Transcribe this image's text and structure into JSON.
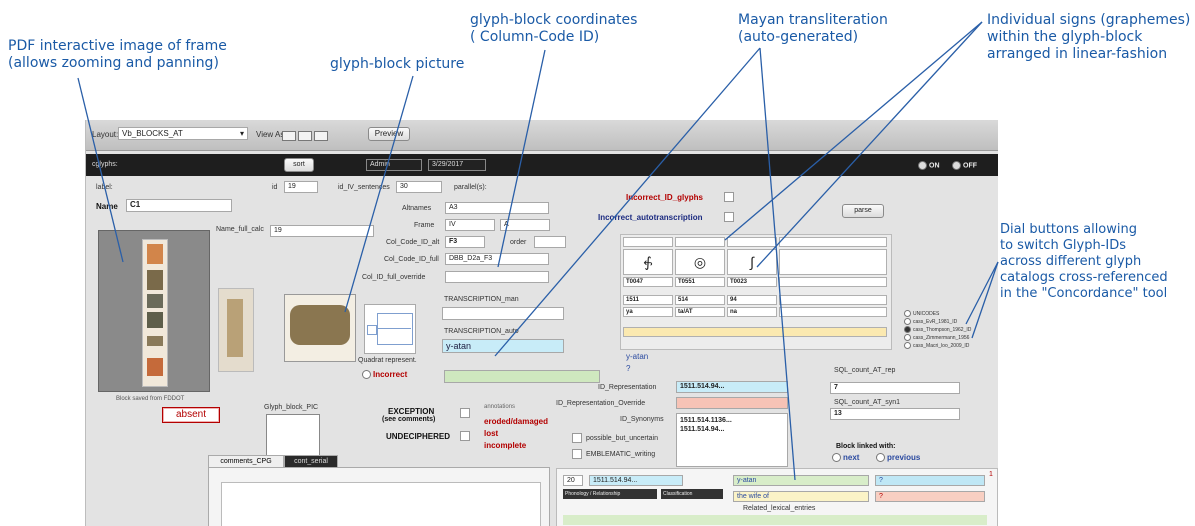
{
  "annotations": {
    "pdf_frame": [
      "PDF interactive image of frame",
      "(allows zooming and panning)"
    ],
    "glyph_block_picture": "glyph-block picture",
    "glyph_block_coordinates": [
      "glyph-block coordinates",
      "( Column-Code ID)"
    ],
    "mayan_transliteration": [
      "Mayan transliteration",
      "(auto-generated)"
    ],
    "individual_signs": [
      "Individual signs (graphemes)",
      "within the glyph-block",
      "arranged in linear-fashion"
    ],
    "dial_buttons": [
      "Dial buttons allowing",
      "to switch Glyph-IDs",
      "across different glyph",
      "catalogs cross-referenced",
      "in the \"Concordance\" tool"
    ]
  },
  "toolbar": {
    "layout_label": "Layout:",
    "layout_value": "Vb_BLOCKS_AT",
    "view_as_label": "View As:",
    "preview_label": "Preview"
  },
  "header": {
    "glyphs_label": "cglyphs:",
    "sort_label": "sort",
    "user_value": "Admin",
    "date_value": "3/29/2017",
    "on_label": "ON",
    "off_label": "OFF"
  },
  "form": {
    "label_label": "label:",
    "id_label": "id",
    "id_value": "19",
    "id_iv_label": "id_IV_sentences",
    "id_iv_value": "30",
    "parallels_label": "parallel(s):",
    "name_label": "Name",
    "name_value": "C1",
    "name_full_calc_label": "Name_full_calc",
    "name_full_calc_value": "19",
    "altnames_label": "Altnames",
    "altnames_value": "A3",
    "frame_label": "Frame",
    "frame_value": "IV",
    "frame_col_value": "A",
    "col_code_auto_label": "Col_Code_ID_alt",
    "col_code_auto_value": "F3",
    "order_label": "order",
    "col_code_full_label": "Col_Code_ID_full",
    "col_code_full_value": "DBB_D2a_F3",
    "col_id_override_label": "Col_ID_full_override",
    "incorrect_id_glyphs": "Incorrect_ID_glyphs",
    "incorrect_autotranscription": "Incorrect_autotranscription",
    "parse_label": "parse",
    "transcription_man_label": "TRANSCRIPTION_man",
    "transcription_auto_label": "TRANSCRIPTION_auto",
    "transcription_auto_value": "y-atan",
    "quadrat_label": "Quadrat represent.",
    "incorrect_label": "Incorrect",
    "block_saved_label": "Block saved from FDDOT",
    "glyph_block_pic_label": "Glyph_block_PIC",
    "absent_label": "absent",
    "exception_label": "EXCEPTION",
    "see_comments_label": "(see comments)",
    "undeciphered_label": "UNDECIPHERED",
    "annotations_label": "annotations",
    "eroded_label": "eroded/damaged",
    "lost_label": "lost",
    "incomplete_label": "incomplete",
    "possible_label": "possible_but_uncertain",
    "emblematic_label": "EMBLEMATIC_writing",
    "id_representation_label": "ID_Representation",
    "id_representation_value": "1511.514.94...",
    "id_rep_override_label": "ID_Representation_Override",
    "id_synonyms_label": "ID_Synonyms",
    "id_synonyms_value": [
      "1511.514.1136...",
      "1511.514.94..."
    ],
    "sql_count_rep_label": "SQL_count_AT_rep",
    "sql_count_rep_value": "7",
    "sql_count_syn_label": "SQL_count_AT_syn1",
    "sql_count_syn_value": "13",
    "block_linked_label": "Block linked with:",
    "next_label": "next",
    "previous_label": "previous",
    "translit_small": "y-atan",
    "question_mark": "?",
    "comments_tab": "comments_CPG",
    "cont_serial_tab": "cont_serial"
  },
  "glyph_grid": {
    "ids": [
      "T0047",
      "T0551",
      "T0023"
    ],
    "codes": [
      "1511",
      "514",
      "94"
    ],
    "readings": [
      "ya",
      "ta/AT",
      "na"
    ]
  },
  "catalogs": [
    "UNICODES",
    "cass_EvR_1981_ID",
    "cass_Thompson_1962_ID",
    "cass_Zimmermann_1956",
    "cass_Macri_loo_2009_ID"
  ],
  "bottom": {
    "num": "20",
    "id_value": "1511.514.94...",
    "phonology_label": "Phonology / Relationship",
    "classification_label": "Classification",
    "translit_value": "y-atan",
    "wife_value": "the wife of",
    "related_label": "Related_lexical_entries",
    "q1": "?",
    "q2": "?",
    "idx": "1"
  }
}
